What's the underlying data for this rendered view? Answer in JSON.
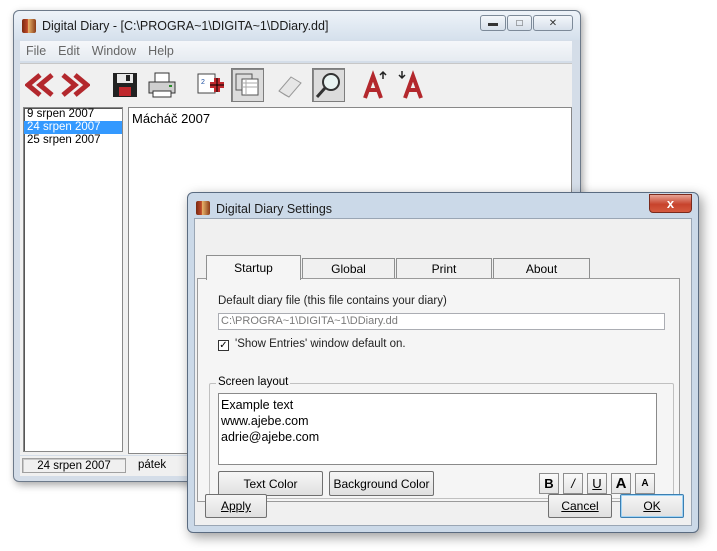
{
  "main_window": {
    "title": "Digital Diary - [C:\\PROGRA~1\\DIGITA~1\\DDiary.dd]",
    "menu": [
      "File",
      "Edit",
      "Window",
      "Help"
    ],
    "toolbar_icons": [
      "previous-icon",
      "next-icon",
      "save-icon",
      "print-icon",
      "add-entry-icon",
      "pages-icon",
      "eraser-icon",
      "search-icon",
      "font-up-icon",
      "font-down-icon"
    ],
    "dates": [
      "9 srpen 2007",
      "24 srpen 2007",
      "25 srpen 2007"
    ],
    "selected_date_index": 1,
    "note_text": "Mácháč 2007",
    "status": {
      "date": "24 srpen 2007",
      "day": "pátek"
    }
  },
  "dialog": {
    "title": "Digital Diary Settings",
    "close_label": "x",
    "tabs": [
      "Startup",
      "Global",
      "Print",
      "About"
    ],
    "active_tab": "Startup",
    "default_file_label": "Default diary file (this file contains your diary)",
    "default_file_value": "C:\\PROGRA~1\\DIGITA~1\\DDiary.dd",
    "show_entries_label": "'Show Entries' window default on.",
    "show_entries_checked": true,
    "screen_layout_label": "Screen layout",
    "layout_lines": [
      "Example text",
      "www.ajebe.com",
      "adrie@ajebe.com"
    ],
    "text_color_label": "Text Color",
    "background_color_label": "Background Color",
    "fmt_bold": "B",
    "fmt_italic": "/",
    "fmt_underline": "U",
    "fmt_grow": "A",
    "fmt_shrink": "A",
    "apply_label": "Apply",
    "cancel_label": "Cancel",
    "ok_label": "OK"
  }
}
